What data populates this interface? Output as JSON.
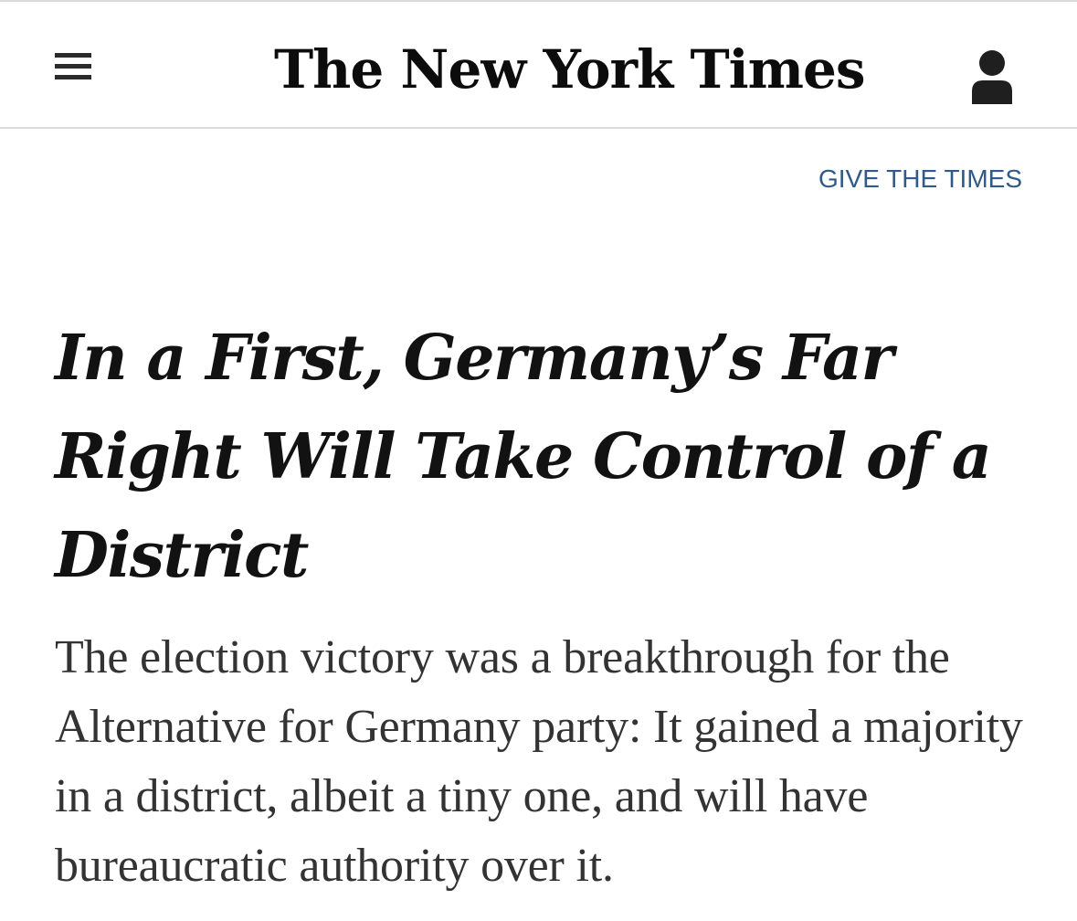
{
  "header": {
    "logo_text": "The New York Times",
    "menu_icon": "hamburger-menu-icon",
    "account_icon": "user-account-icon"
  },
  "promo": {
    "give_label": "GIVE THE TIMES"
  },
  "article": {
    "headline": "In a First, Germany’s Far Right Will Take Control of a District",
    "summary": "The election victory was a breakthrough for the Alternative for Germany party: It gained a majority in a district, albeit a tiny one, and will have bureaucratic authority over it."
  },
  "colors": {
    "link": "#2f5a8a",
    "text": "#121212",
    "summary_text": "#333333",
    "divider": "#dcdcdc"
  }
}
